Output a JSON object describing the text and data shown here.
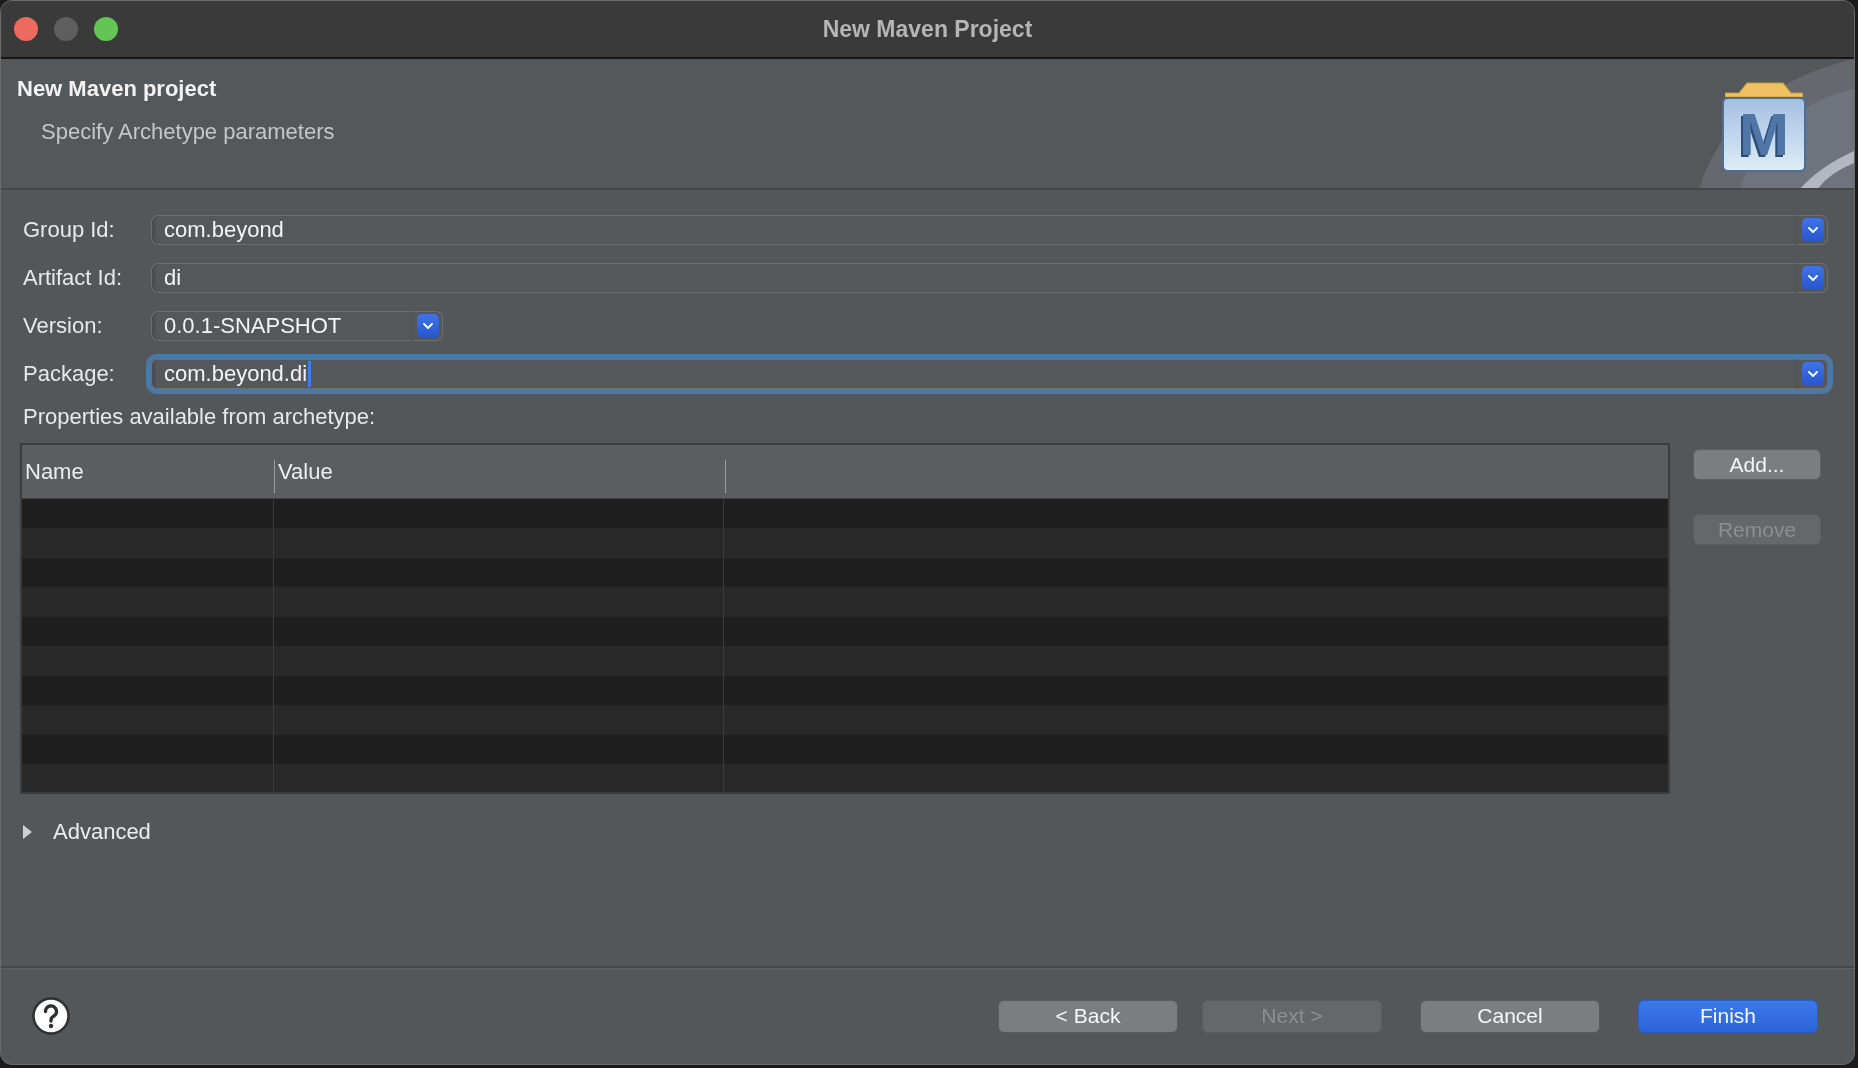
{
  "window": {
    "title": "New Maven Project",
    "controls": [
      {
        "kind": "close",
        "disabled": false
      },
      {
        "kind": "minimize",
        "disabled": true
      },
      {
        "kind": "zoom",
        "disabled": false
      }
    ]
  },
  "header": {
    "title": "New Maven project",
    "subtitle": "Specify Archetype parameters",
    "logo_letter": "M"
  },
  "form": {
    "fields": [
      {
        "label": "Group Id:",
        "value": "com.beyond",
        "kind": "combo",
        "focused": false
      },
      {
        "label": "Artifact Id:",
        "value": "di",
        "kind": "combo",
        "focused": false
      },
      {
        "label": "Version:",
        "value": "0.0.1-SNAPSHOT",
        "kind": "short_combo",
        "focused": false
      },
      {
        "label": "Package:",
        "value": "com.beyond.di",
        "kind": "combo",
        "focused": true
      }
    ]
  },
  "properties": {
    "label": "Properties available from archetype:",
    "columns": [
      "Name",
      "Value"
    ],
    "buttons": [
      {
        "label": "Add...",
        "disabled": false
      },
      {
        "label": "Remove",
        "disabled": true
      }
    ]
  },
  "advanced": {
    "label": "Advanced",
    "expanded": false
  },
  "footer": {
    "nav_buttons": [
      {
        "label": "< Back",
        "disabled": false,
        "default": false
      },
      {
        "label": "Next >",
        "disabled": true,
        "default": false
      }
    ],
    "action_buttons": [
      {
        "label": "Cancel",
        "disabled": false,
        "default": false
      },
      {
        "label": "Finish",
        "disabled": false,
        "default": true
      }
    ]
  }
}
